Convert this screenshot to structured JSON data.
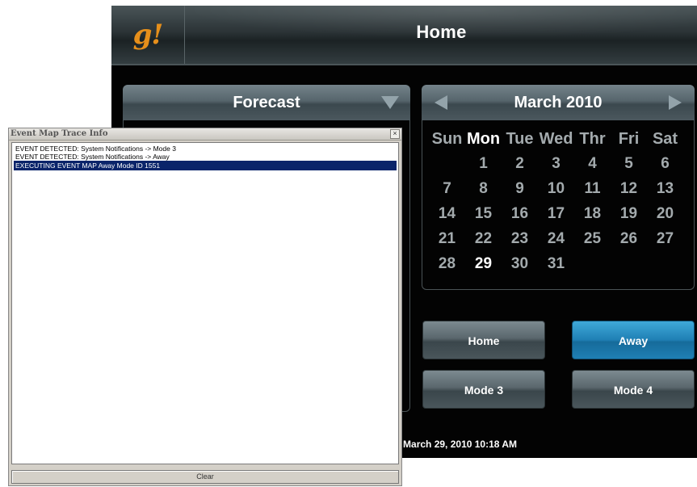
{
  "panel": {
    "logo": "g!",
    "title": "Home",
    "forecast": {
      "title": "Forecast"
    },
    "calendar": {
      "month_label": "March 2010",
      "day_names": [
        "Sun",
        "Mon",
        "Tue",
        "Wed",
        "Thr",
        "Fri",
        "Sat"
      ],
      "weeks": [
        [
          "",
          "1",
          "2",
          "3",
          "4",
          "5",
          "6"
        ],
        [
          "7",
          "8",
          "9",
          "10",
          "11",
          "12",
          "13"
        ],
        [
          "14",
          "15",
          "16",
          "17",
          "18",
          "19",
          "20"
        ],
        [
          "21",
          "22",
          "23",
          "24",
          "25",
          "26",
          "27"
        ],
        [
          "28",
          "29",
          "30",
          "31",
          "",
          "",
          ""
        ]
      ],
      "highlighted_day_name": "Mon",
      "today": "29"
    },
    "modes": {
      "home": "Home",
      "away": "Away",
      "mode3": "Mode 3",
      "mode4": "Mode 4",
      "active": "Away"
    },
    "datetime": "March 29, 2010  10:18 AM"
  },
  "trace": {
    "title": "Event Map Trace Info",
    "close_glyph": "×",
    "lines": [
      "EVENT DETECTED: System Notifications -> Mode 3",
      "EVENT DETECTED: System Notifications -> Away",
      "EXECUTING EVENT MAP Away Mode ID 1551"
    ],
    "selected_index": 2,
    "clear_label": "Clear"
  },
  "colors": {
    "panel_bg": "#030303",
    "accent_orange": "#e68f1b",
    "active_button": "#1f7fb4",
    "selection": "#0a246a"
  }
}
